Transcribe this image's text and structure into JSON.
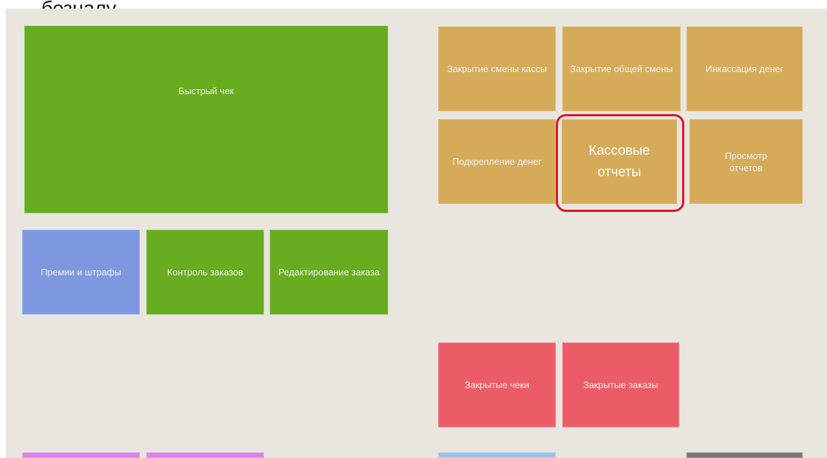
{
  "caption": "безналу",
  "tiles": {
    "quick_check": "Быстрый чек",
    "bonuses_fines": "Премии и штрафы",
    "order_control": "Контроль заказов",
    "order_editing": "Редактирование заказа",
    "close_register_shift": "Закрытие смены кассы",
    "close_general_shift": "Закрытие общей смены",
    "cash_collection": "Инкассация денег",
    "cash_reinforcement": "Подкрепление денег",
    "cash_reports": "Кассовые отчеты",
    "view_reports": "Просмотр отчетов",
    "closed_checks": "Закрытые чеки",
    "closed_orders": "Закрытые заказы"
  },
  "colors": {
    "green": "#67ad1f",
    "blue": "#7e98e0",
    "gold": "#d5ab5a",
    "red": "#ec5c66",
    "highlight": "#d9161f"
  }
}
